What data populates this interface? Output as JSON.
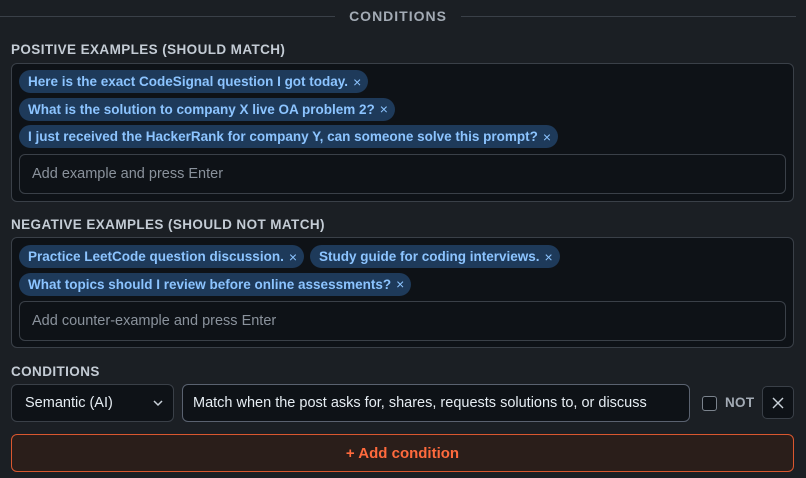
{
  "section": {
    "title": "CONDITIONS"
  },
  "positive": {
    "label": "POSITIVE EXAMPLES (SHOULD MATCH)",
    "chips": [
      "Here is the exact CodeSignal question I got today.",
      "What is the solution to company X live OA problem 2?",
      "I just received the HackerRank for company Y, can someone solve this prompt?"
    ],
    "placeholder": "Add example and press Enter"
  },
  "negative": {
    "label": "NEGATIVE EXAMPLES (SHOULD NOT MATCH)",
    "chips": [
      "Practice LeetCode question discussion.",
      "Study guide for coding interviews.",
      "What topics should I review before online assessments?"
    ],
    "placeholder": "Add counter-example and press Enter"
  },
  "conditions": {
    "label": "CONDITIONS",
    "type_value": "Semantic (AI)",
    "text_value": "Match when the post asks for, shares, requests solutions to, or discuss",
    "not_label": "NOT",
    "add_label": "+ Add condition"
  },
  "chip_close_glyph": "×",
  "colors": {
    "background": "#1b1f24",
    "chip_bg": "#1e3a5a",
    "chip_text": "#8cc4ff",
    "accent": "#ff6a3d"
  }
}
